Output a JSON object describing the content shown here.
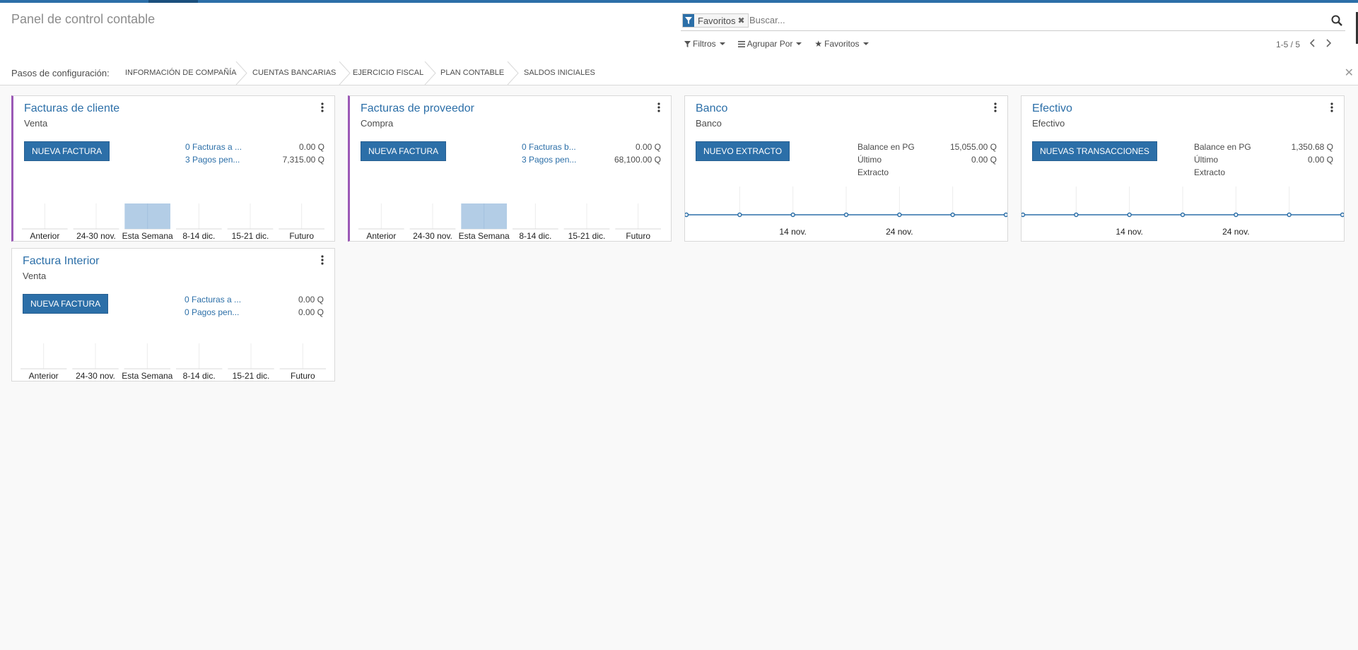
{
  "colors": {
    "accent": "#2c6fa8",
    "purple": "#9b59b6",
    "bar": "#b3cde6"
  },
  "header": {
    "title": "Panel de control contable",
    "facet_label": "Favoritos",
    "search_placeholder": "Buscar...",
    "filters_label": "Filtros",
    "groupby_label": "Agrupar Por",
    "favorites_label": "Favoritos",
    "pager": "1-5 / 5"
  },
  "onboarding": {
    "label": "Pasos de configuración:",
    "steps": [
      "Información de compañía",
      "Cuentas bancarias",
      "Ejercicio fiscal",
      "Plan contable",
      "Saldos iniciales"
    ]
  },
  "bar_categories": [
    "Anterior",
    "24-30 nov.",
    "Esta Semana",
    "8-14 dic.",
    "15-21 dic.",
    "Futuro"
  ],
  "cards": [
    {
      "title": "Facturas de cliente",
      "subtitle": "Venta",
      "button": "Nueva Factura",
      "rows": [
        {
          "label": "0 Facturas a ...",
          "value": "0.00 Q"
        },
        {
          "label": "3 Pagos pen...",
          "value": "7,315.00 Q"
        }
      ],
      "chart_data": {
        "type": "bar",
        "categories": [
          "Anterior",
          "24-30 nov.",
          "Esta Semana",
          "8-14 dic.",
          "15-21 dic.",
          "Futuro"
        ],
        "values": [
          0,
          0,
          7315,
          0,
          0,
          0
        ]
      }
    },
    {
      "title": "Facturas de proveedor",
      "subtitle": "Compra",
      "button": "Nueva Factura",
      "rows": [
        {
          "label": "0 Facturas b...",
          "value": "0.00 Q"
        },
        {
          "label": "3 Pagos pen...",
          "value": "68,100.00 Q"
        }
      ],
      "chart_data": {
        "type": "bar",
        "categories": [
          "Anterior",
          "24-30 nov.",
          "Esta Semana",
          "8-14 dic.",
          "15-21 dic.",
          "Futuro"
        ],
        "values": [
          0,
          0,
          68100,
          0,
          0,
          0
        ]
      }
    },
    {
      "title": "Banco",
      "subtitle": "Banco",
      "button": "Nuevo Extracto",
      "rows": [
        {
          "label": "Balance en PG",
          "value": "15,055.00 Q"
        },
        {
          "label": "Último",
          "value": "0.00 Q"
        },
        {
          "label": "Extracto",
          "value": ""
        }
      ],
      "chart_data": {
        "type": "line",
        "xticks": [
          "14 nov.",
          "24 nov."
        ],
        "points": 7
      }
    },
    {
      "title": "Efectivo",
      "subtitle": "Efectivo",
      "button": "Nuevas Transacciones",
      "rows": [
        {
          "label": "Balance en PG",
          "value": "1,350.68 Q"
        },
        {
          "label": "Último",
          "value": "0.00 Q"
        },
        {
          "label": "Extracto",
          "value": ""
        }
      ],
      "chart_data": {
        "type": "line",
        "xticks": [
          "14 nov.",
          "24 nov."
        ],
        "points": 7
      }
    },
    {
      "title": "Factura Interior",
      "subtitle": "Venta",
      "button": "Nueva Factura",
      "rows": [
        {
          "label": "0 Facturas a ...",
          "value": "0.00 Q"
        },
        {
          "label": "0 Pagos pen...",
          "value": "0.00 Q"
        }
      ],
      "chart_data": {
        "type": "bar",
        "categories": [
          "Anterior",
          "24-30 nov.",
          "Esta Semana",
          "8-14 dic.",
          "15-21 dic.",
          "Futuro"
        ],
        "values": [
          0,
          0,
          0,
          0,
          0,
          0
        ]
      }
    }
  ]
}
